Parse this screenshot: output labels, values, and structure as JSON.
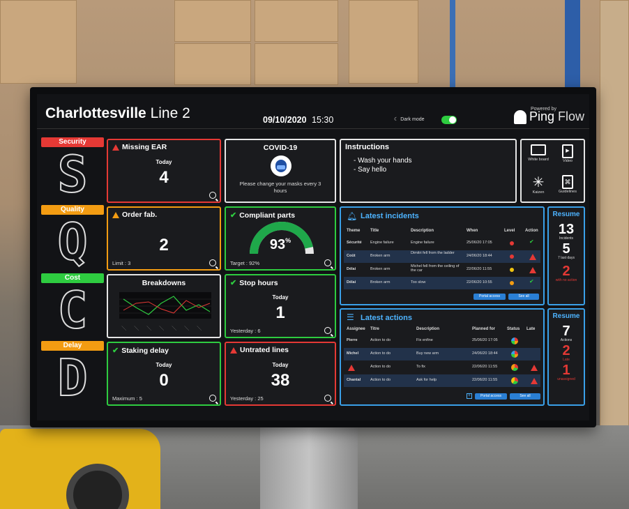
{
  "header": {
    "title_bold": "Charlottesville",
    "title_rest": "Line 2",
    "date": "09/10/2020",
    "time": "15:30",
    "dark_mode_label": "Dark mode",
    "powered_by": "Powered by",
    "brand_a": "Ping",
    "brand_b": "Flow"
  },
  "sqcd": [
    {
      "label": "Security",
      "letter": "S",
      "color": "#e53935"
    },
    {
      "label": "Quality",
      "letter": "Q",
      "color": "#f39c12"
    },
    {
      "label": "Cost",
      "letter": "C",
      "color": "#2ecc40"
    },
    {
      "label": "Delay",
      "letter": "D",
      "color": "#f39c12"
    }
  ],
  "cards": {
    "missing_ear": {
      "title": "Missing EAR",
      "sub": "Today",
      "value": "4"
    },
    "order_fab": {
      "title": "Order fab.",
      "value": "2",
      "foot": "Limit : 3"
    },
    "breakdowns": {
      "title": "Breakdowns"
    },
    "staking_delay": {
      "title": "Staking delay",
      "sub": "Today",
      "value": "0",
      "foot": "Maximum : 5"
    },
    "covid": {
      "title": "COVID-19",
      "text": "Please change your masks every 3 hours"
    },
    "compliant": {
      "title": "Compliant parts",
      "value": "93",
      "unit": "%",
      "foot": "Target : 92%",
      "gauge_fraction": 0.93
    },
    "stop_hours": {
      "title": "Stop hours",
      "sub": "Today",
      "value": "1",
      "foot": "Yesterday : 6"
    },
    "untrated": {
      "title": "Untrated lines",
      "sub": "Today",
      "value": "38",
      "foot": "Yesterday : 25"
    }
  },
  "instructions": {
    "title": "Instructions",
    "items": [
      "- Wash your hands",
      "- Say hello"
    ]
  },
  "shortcuts": [
    "White board",
    "Video",
    "Kaizen",
    "Guidelines"
  ],
  "incidents": {
    "title": "Latest incidents",
    "headers": [
      "Theme",
      "Title",
      "Description",
      "When",
      "Level",
      "Action"
    ],
    "rows": [
      {
        "theme": "Sécurité",
        "title": "Engine failure",
        "desc": "Engine failure",
        "when": "25/06/20 17:05",
        "level": "#e53935",
        "action": "check"
      },
      {
        "theme": "Coût",
        "title": "Broken arm",
        "desc": "Dimitri fell from the ladder",
        "when": "24/06/20 18:44",
        "level": "#e53935",
        "action": "warn"
      },
      {
        "theme": "Délai",
        "title": "Broken arm",
        "desc": "Michel fell from the ceiling of the car",
        "when": "22/06/20 11:55",
        "level": "#f1c40f",
        "action": "warn"
      },
      {
        "theme": "Délai",
        "title": "Broken arm",
        "desc": "Too slow",
        "when": "22/06/20 10:55",
        "level": "#f39c12",
        "action": "check"
      }
    ],
    "btn_portal": "Portal access",
    "btn_all": "See all"
  },
  "actions": {
    "title": "Latest actions",
    "headers": [
      "Assignee",
      "Titre",
      "Description",
      "Planned for",
      "Status",
      "Late"
    ],
    "rows": [
      {
        "assignee": "Pierre",
        "title": "Action to do",
        "desc": "Fix enfine",
        "when": "25/06/20 17:05",
        "late": ""
      },
      {
        "assignee": "Michel",
        "title": "Action to do",
        "desc": "Buy new arm",
        "when": "24/06/20 18:44",
        "late": ""
      },
      {
        "assignee": "",
        "title": "Action to do",
        "desc": "To fix",
        "when": "22/06/20 11:55",
        "late": "warn"
      },
      {
        "assignee": "Chantal",
        "title": "Action to do",
        "desc": "Ask for help",
        "when": "22/06/20 11:55",
        "late": "warn"
      }
    ],
    "btn_portal": "Portal access",
    "btn_all": "See all"
  },
  "resume1": {
    "title": "Resume",
    "n1": "13",
    "l1": "Incidents",
    "n2": "5",
    "l2": "7 last days",
    "n3": "2",
    "l3": "with no action"
  },
  "resume2": {
    "title": "Resume",
    "n1": "7",
    "l1": "Actions",
    "n2": "2",
    "l2": "Late",
    "n3": "1",
    "l3": "unassigned"
  },
  "colors": {
    "red": "#e53935",
    "orange": "#f39c12",
    "green": "#2ecc40",
    "blue": "#3aa0e8"
  }
}
